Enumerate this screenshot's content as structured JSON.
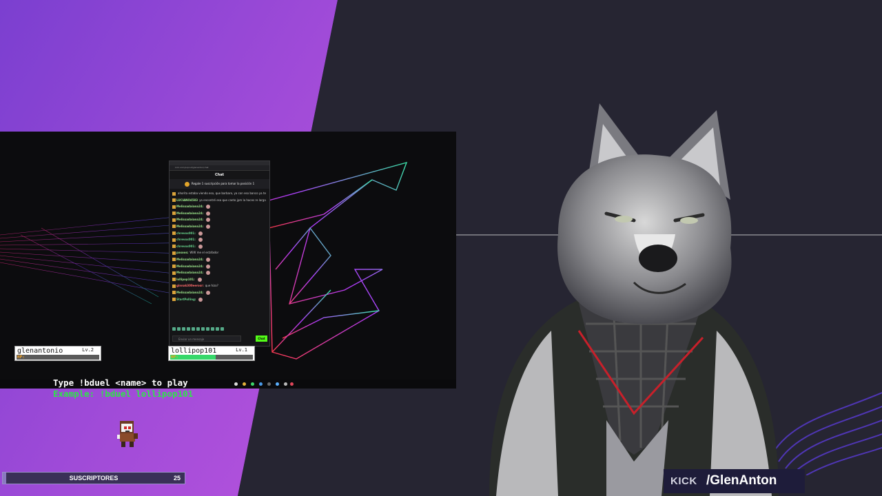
{
  "chat_window": {
    "url": "kick.com/popout/glenanton/chat",
    "heading": "Chat",
    "pinned": "Regale 1 suscripción para tomar la posición 1",
    "messages": [
      {
        "user": "",
        "text": "ahorita estaba viendo eso, que barbaro, ya con eso banco ya te hizo multimillonario",
        "style": "u2"
      },
      {
        "user": "LUCIANO4583",
        "text": "ya encontré eso que canto jpm la haces re larga",
        "style": "u"
      },
      {
        "user": "Melissadaiana24:",
        "text": "",
        "style": "u"
      },
      {
        "user": "Melissadaiana24:",
        "text": "",
        "style": "u"
      },
      {
        "user": "Melissadaiana24:",
        "text": "",
        "style": "u"
      },
      {
        "user": "Melissadaiana24:",
        "text": "",
        "style": "u"
      },
      {
        "user": "chrevox001:",
        "text": "",
        "style": "u3"
      },
      {
        "user": "chrevox001:",
        "text": "",
        "style": "u3"
      },
      {
        "user": "chrevox001:",
        "text": "",
        "style": "u3"
      },
      {
        "user": "pasoos:",
        "text": "WiW me el estafador",
        "style": "u"
      },
      {
        "user": "Melissadaiana24:",
        "text": "",
        "style": "u"
      },
      {
        "user": "Melissadaiana24:",
        "text": "",
        "style": "u"
      },
      {
        "user": "Melissadaiana24:",
        "text": "",
        "style": "u"
      },
      {
        "user": "lollipop101:",
        "text": "",
        "style": "u"
      },
      {
        "user": "ginnak300eerosr:",
        "text": "que hizo?",
        "style": "u2"
      },
      {
        "user": "Melissadaiana24:",
        "text": "",
        "style": "u"
      },
      {
        "user": "StartPolling:",
        "text": "",
        "style": "u3"
      }
    ],
    "input_placeholder": "Enviar un mensaje",
    "send_label": "Chat"
  },
  "duel": {
    "player1": {
      "name": "glenantonio",
      "level": "Lv.2",
      "hp_label": "HP:",
      "hp_fraction": 0.0
    },
    "player2": {
      "name": "lollipop101",
      "level": "Lv.1",
      "hp_label": "HP:",
      "hp_fraction": 0.55
    },
    "instruction": "Type !bduel <name> to play",
    "example": "Example: !bduel lollipop101"
  },
  "subs_goal": {
    "label": "SUSCRIPTORES",
    "count": "25",
    "progress": 0.02
  },
  "kick": {
    "logo": "KICK",
    "handle": "/GlenAnton"
  },
  "colors": {
    "kick_green": "#53fc18",
    "instruction_white": "#ffffff",
    "example_green": "#2fe34a",
    "hp_orange": "#f4a020"
  }
}
